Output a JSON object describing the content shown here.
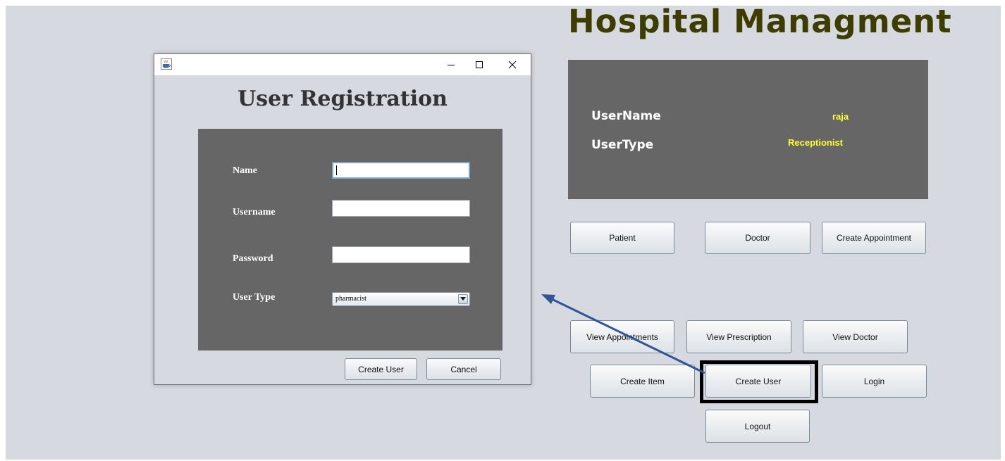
{
  "app": {
    "title": "Hospital Managment"
  },
  "session": {
    "username_label": "UserName",
    "username_value": "raja",
    "usertype_label": "UserType",
    "usertype_value": "Receptionist"
  },
  "main_buttons": {
    "patient": "Patient",
    "doctor": "Doctor",
    "create_appointment": "Create Appointment",
    "view_appointments": "View Appointments",
    "view_prescription": "View Prescription",
    "view_doctor": "View Doctor",
    "create_item": "Create Item",
    "create_user": "Create User",
    "login": "Login",
    "logout": "Logout"
  },
  "dialog": {
    "heading": "User Registration",
    "fields": {
      "name_label": "Name",
      "name_value": "",
      "username_label": "Username",
      "username_value": "",
      "password_label": "Password",
      "password_value": "",
      "usertype_label": "User Type",
      "usertype_selected": "pharmacist"
    },
    "buttons": {
      "create_user": "Create User",
      "cancel": "Cancel"
    }
  },
  "colors": {
    "background": "#d6d9df",
    "panel": "#666666",
    "title": "#3d3d00",
    "value_highlight": "#ffff33",
    "arrow": "#2f5597"
  },
  "icons": {
    "dialog_app_icon": "java-cup-icon",
    "minimize": "minimize-icon",
    "maximize": "maximize-icon",
    "close": "close-icon",
    "combo_dropdown": "chevron-down-icon"
  }
}
